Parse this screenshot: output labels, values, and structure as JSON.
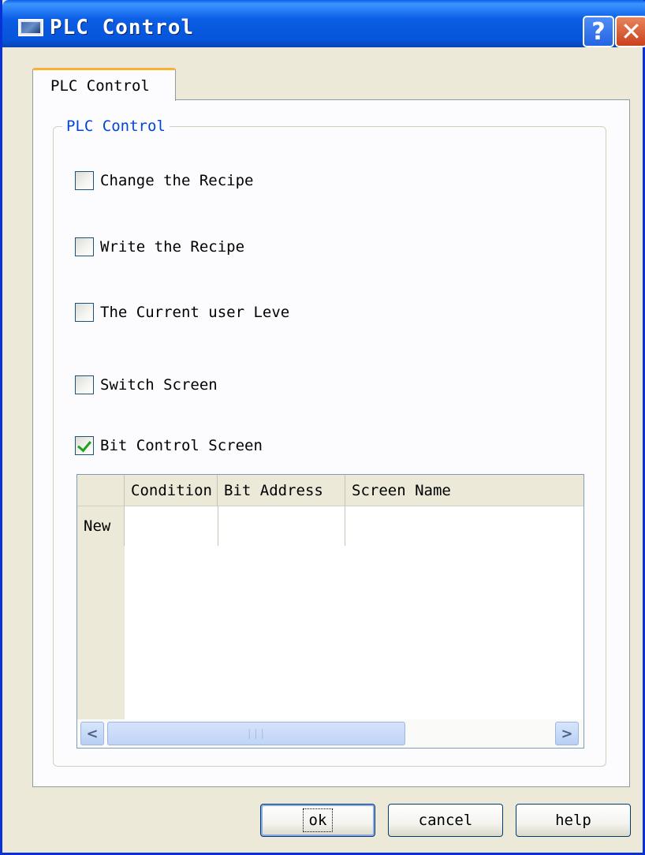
{
  "window": {
    "title": "PLC Control",
    "help_button": "?",
    "close_button": "✕"
  },
  "tab": {
    "label": "PLC Control"
  },
  "group": {
    "legend": "PLC Control"
  },
  "options": [
    {
      "label": "Change the Recipe",
      "checked": false
    },
    {
      "label": "Write the Recipe",
      "checked": false
    },
    {
      "label": "The Current user Leve",
      "checked": false
    },
    {
      "label": "Switch Screen",
      "checked": false
    },
    {
      "label": "Bit Control Screen",
      "checked": true
    }
  ],
  "grid": {
    "columns": [
      "Condition",
      "Bit Address",
      "Screen Name"
    ],
    "new_row_label": "New",
    "scroll_left": "<",
    "scroll_right": ">",
    "thumb_grip": "|||"
  },
  "buttons": {
    "ok": "ok",
    "cancel": "cancel",
    "help": "help"
  },
  "colors": {
    "title_bar": "#0654d9",
    "legend_text": "#0046d5",
    "check_mark": "#21a121"
  },
  "icons": {
    "window_icon": "app-window-icon",
    "help_icon": "question-mark-icon",
    "close_icon": "close-icon"
  }
}
